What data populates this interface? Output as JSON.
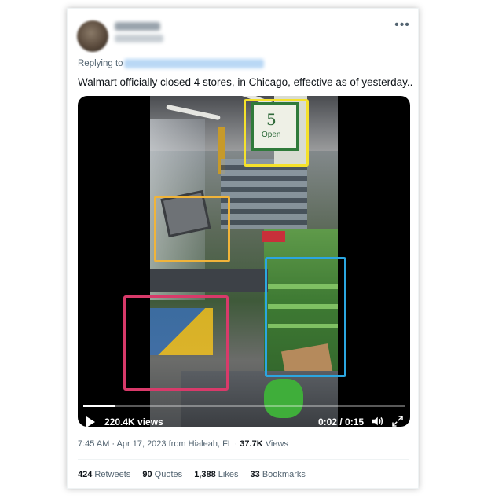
{
  "tweet": {
    "replying_to_label": "Replying to",
    "text": "Walmart officially closed 4 stores, in Chicago, effective as of yesterday...",
    "more_icon": "more-dots-icon"
  },
  "video": {
    "sign_number": "5",
    "sign_text": "Open",
    "views": "220.4K views",
    "time": "0:02 / 0:15",
    "progress": 0.1,
    "highlight_colors": {
      "yellow": "#f5e12b",
      "orange": "#f0b43a",
      "blue": "#2ba6e0",
      "pink": "#d83a6a"
    }
  },
  "meta": {
    "time": "7:45 AM",
    "sep1": "·",
    "date": "Apr 17, 2023 from Hialeah, FL",
    "sep2": "·",
    "views_count": "37.7K",
    "views_label": "Views"
  },
  "stats": [
    {
      "count": "424",
      "label": "Retweets"
    },
    {
      "count": "90",
      "label": "Quotes"
    },
    {
      "count": "1,388",
      "label": "Likes"
    },
    {
      "count": "33",
      "label": "Bookmarks"
    }
  ]
}
